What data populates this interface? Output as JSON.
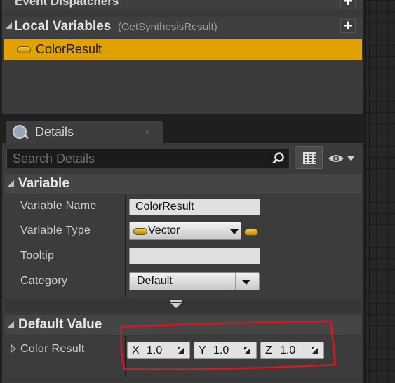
{
  "my_blueprint": {
    "event_dispatchers_label": "Event Dispatchers",
    "local_variables_label": "Local Variables",
    "local_variables_context": "(GetSynthesisResult)",
    "variables": [
      {
        "name": "ColorResult",
        "type_color": "#e1a200"
      }
    ],
    "add_icon": "plus-icon"
  },
  "details": {
    "tab_label": "Details",
    "tab_close": "×",
    "search_placeholder": "Search Details",
    "variable_section": {
      "title": "Variable",
      "variable_name_label": "Variable Name",
      "variable_name_value": "ColorResult",
      "variable_type_label": "Variable Type",
      "variable_type_value": "Vector",
      "tooltip_label": "Tooltip",
      "tooltip_value": "",
      "category_label": "Category",
      "category_value": "Default"
    },
    "default_value_section": {
      "title": "Default Value",
      "property_label": "Color Result",
      "x_label": "X",
      "x_value": "1.0",
      "y_label": "Y",
      "y_value": "1.0",
      "z_label": "Z",
      "z_value": "1.0"
    }
  },
  "colors": {
    "selection": "#e1a200",
    "panel": "#3a3a3a",
    "annotation": "#e0141c"
  }
}
